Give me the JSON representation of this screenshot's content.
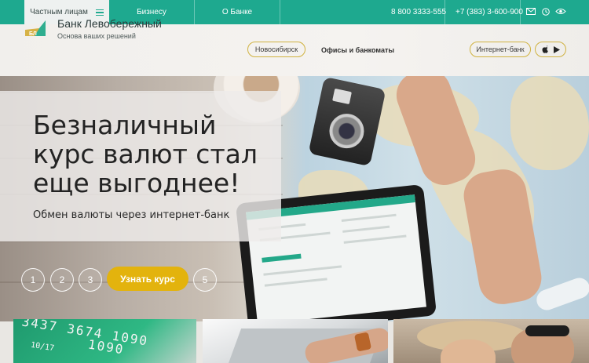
{
  "topbar": {
    "segments": [
      "Частным лицам",
      "Бизнесу",
      "О Банке"
    ],
    "phone_free": "8 800 3333-555",
    "phone_local": "+7 (383) 3-600-900",
    "icons": [
      "mail-icon",
      "clock-icon",
      "eye-icon"
    ],
    "colors": {
      "bar": "#1ea98f",
      "active_tab": "#eef1f0"
    }
  },
  "header": {
    "logo_title": "Банк Левобережный",
    "logo_sub": "Основа ваших решений",
    "city": "Новосибирск",
    "offices_link": "Офисы и банкоматы",
    "internet_bank": "Интернет-банк",
    "app_icons": [
      "apple-icon",
      "play-store-icon"
    ],
    "accent": "#d0b240"
  },
  "hero": {
    "headline": "Безналичный курс валют стал еще выгоднее!",
    "subline": "Обмен валюты через интернет-банк",
    "slides": [
      "1",
      "2",
      "3",
      "5"
    ],
    "cta": "Узнать курс",
    "cta_color": "#e3b30d"
  },
  "cards": {
    "card1_digits_top": "3437 3674 1090",
    "card1_digits_mid": "10/17",
    "card1_digits_right": "1090"
  }
}
